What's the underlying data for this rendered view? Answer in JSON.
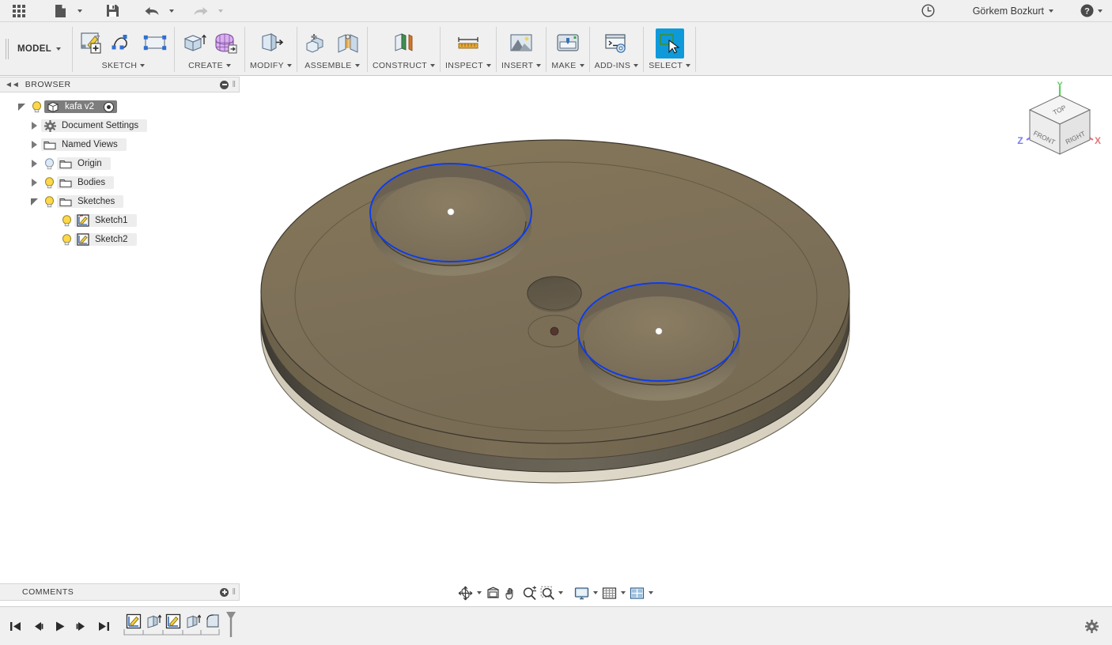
{
  "app": {
    "title": "Fusion 360",
    "user_name": "Görkem Bozkurt",
    "workspace": "MODEL"
  },
  "quick_access": {
    "items": [
      {
        "name": "app-grid-menu",
        "label": "Show Data Panel",
        "icon": "grid-icon"
      },
      {
        "name": "file-menu",
        "label": "File",
        "icon": "file-icon",
        "has_caret": true
      },
      {
        "name": "save-button",
        "label": "Save",
        "icon": "save-icon"
      },
      {
        "name": "undo-button",
        "label": "Undo",
        "icon": "undo-arrow-icon",
        "has_caret": true
      },
      {
        "name": "redo-button",
        "label": "Redo",
        "icon": "redo-arrow-icon",
        "has_caret": true,
        "disabled": true
      }
    ],
    "recent_icon": "clock-icon",
    "help_label": "Help",
    "help_icon": "question-mark-icon"
  },
  "ribbon": {
    "workspace_label": "MODEL",
    "panels": [
      {
        "title": "SKETCH",
        "tools": [
          {
            "name": "create-sketch-tool",
            "label": "Create Sketch",
            "icon": "sketch-plus-icon"
          },
          {
            "name": "spline-tool",
            "label": "Spline",
            "icon": "spline-icon"
          },
          {
            "name": "rectangle-tool",
            "label": "Rectangle",
            "icon": "rectangle-icon"
          }
        ]
      },
      {
        "title": "CREATE",
        "tools": [
          {
            "name": "extrude-tool",
            "label": "Extrude",
            "icon": "extrude-icon"
          },
          {
            "name": "create-form-tool",
            "label": "Create Form",
            "icon": "form-mesh-icon"
          }
        ]
      },
      {
        "title": "MODIFY",
        "tools": [
          {
            "name": "press-pull-tool",
            "label": "Press Pull",
            "icon": "press-pull-icon"
          }
        ]
      },
      {
        "title": "ASSEMBLE",
        "tools": [
          {
            "name": "new-component-tool",
            "label": "New Component",
            "icon": "new-component-icon"
          },
          {
            "name": "joint-tool",
            "label": "Joint",
            "icon": "joint-icon"
          }
        ]
      },
      {
        "title": "CONSTRUCT",
        "tools": [
          {
            "name": "offset-plane-tool",
            "label": "Offset Plane",
            "icon": "offset-plane-icon"
          }
        ]
      },
      {
        "title": "INSPECT",
        "tools": [
          {
            "name": "measure-tool",
            "label": "Measure",
            "icon": "ruler-icon"
          }
        ]
      },
      {
        "title": "INSERT",
        "tools": [
          {
            "name": "insert-image-tool",
            "label": "Insert Image",
            "icon": "image-icon"
          }
        ]
      },
      {
        "title": "MAKE",
        "tools": [
          {
            "name": "3d-print-tool",
            "label": "3D Print",
            "icon": "printer-icon"
          }
        ]
      },
      {
        "title": "ADD-INS",
        "tools": [
          {
            "name": "scripts-addins-tool",
            "label": "Scripts and Add-Ins",
            "icon": "console-gear-icon"
          }
        ]
      },
      {
        "title": "SELECT",
        "tools": [
          {
            "name": "select-tool",
            "label": "Select",
            "icon": "select-cursor-icon",
            "active": true
          }
        ]
      }
    ]
  },
  "browser": {
    "title": "BROWSER",
    "collapse_icon": "collapse-left-icon",
    "minimize_icon": "minus-circle-icon",
    "tree": [
      {
        "name": "kafa v2",
        "indent": 0,
        "twisty": "expanded",
        "bulb": "on",
        "icon": "component-icon",
        "selected": true,
        "has_radio": true
      },
      {
        "name": "Document Settings",
        "indent": 1,
        "twisty": "collapsed",
        "bulb": "none",
        "icon": "gear-icon",
        "selected": false
      },
      {
        "name": "Named Views",
        "indent": 1,
        "twisty": "collapsed",
        "bulb": "none",
        "icon": "folder-icon",
        "selected": false
      },
      {
        "name": "Origin",
        "indent": 1,
        "twisty": "collapsed",
        "bulb": "off",
        "icon": "folder-icon",
        "selected": false
      },
      {
        "name": "Bodies",
        "indent": 1,
        "twisty": "collapsed",
        "bulb": "on",
        "icon": "folder-icon",
        "selected": false
      },
      {
        "name": "Sketches",
        "indent": 1,
        "twisty": "expanded",
        "bulb": "on",
        "icon": "folder-icon",
        "selected": false
      },
      {
        "name": "Sketch1",
        "indent": 2,
        "twisty": "none",
        "bulb": "on",
        "icon": "sketch-red-icon",
        "selected": false
      },
      {
        "name": "Sketch2",
        "indent": 2,
        "twisty": "none",
        "bulb": "on",
        "icon": "sketch-icon",
        "selected": false
      }
    ]
  },
  "comments": {
    "title": "COMMENTS",
    "add_icon": "plus-circle-icon"
  },
  "view_cube": {
    "faces": {
      "top": "TOP",
      "front": "FRONT",
      "right": "RIGHT"
    },
    "axes": [
      {
        "label": "X",
        "color": "#e8747c"
      },
      {
        "label": "Y",
        "color": "#5fce5f"
      },
      {
        "label": "Z",
        "color": "#7b7bf0"
      }
    ]
  },
  "nav_bar": {
    "items": [
      {
        "name": "orbit-tool",
        "label": "Orbit",
        "icon": "orbit-icon",
        "has_caret": true
      },
      {
        "name": "look-at-tool",
        "label": "Look At",
        "icon": "look-at-icon",
        "has_caret": false
      },
      {
        "name": "pan-tool",
        "label": "Pan",
        "icon": "hand-icon",
        "has_caret": false
      },
      {
        "name": "zoom-tool",
        "label": "Zoom",
        "icon": "magnifier-plusminus-icon",
        "has_caret": false
      },
      {
        "name": "zoom-window-tool",
        "label": "Fit",
        "icon": "magnifier-window-icon",
        "has_caret": true
      },
      {
        "name": "display-settings",
        "label": "Display Settings",
        "icon": "monitor-icon",
        "has_caret": true
      },
      {
        "name": "grid-snaps",
        "label": "Grid and Snaps",
        "icon": "grid-square-icon",
        "has_caret": true
      },
      {
        "name": "viewports",
        "label": "Viewports",
        "icon": "viewports-icon",
        "has_caret": true
      }
    ]
  },
  "timeline": {
    "playback": [
      {
        "name": "jump-to-beginning-button",
        "label": "Go to Beginning",
        "icon": "skip-back-icon"
      },
      {
        "name": "step-back-button",
        "label": "Step Back",
        "icon": "step-back-icon"
      },
      {
        "name": "play-button",
        "label": "Play",
        "icon": "play-icon"
      },
      {
        "name": "step-forward-button",
        "label": "Step Forward",
        "icon": "step-forward-icon"
      },
      {
        "name": "jump-to-end-button",
        "label": "Go to End",
        "icon": "skip-forward-icon"
      }
    ],
    "features": [
      {
        "name": "timeline-feature-sketch1",
        "label": "Sketch1",
        "icon": "sketch-icon"
      },
      {
        "name": "timeline-feature-extrude1",
        "label": "Extrude1",
        "icon": "extrude-icon"
      },
      {
        "name": "timeline-feature-sketch2",
        "label": "Sketch2",
        "icon": "sketch-icon"
      },
      {
        "name": "timeline-feature-extrude2",
        "label": "Extrude2",
        "icon": "extrude-icon"
      },
      {
        "name": "timeline-feature-fillet1",
        "label": "Fillet1",
        "icon": "fillet-icon"
      }
    ],
    "marker_name": "timeline-marker",
    "settings_icon": "gear-icon"
  },
  "model": {
    "description": "Cylindrical disc part with two large counterbored pockets, one through hole and one small center hole",
    "body_color": "#7d7059",
    "rim_color": "#58534a",
    "base_color": "#ddd7c9",
    "sketch_color": "#0b3cf0",
    "point_color": "#ffffff",
    "features": [
      {
        "name": "pocket-upper-left",
        "selected_sketch": true,
        "center_point": true
      },
      {
        "name": "pocket-lower-right",
        "selected_sketch": true,
        "center_point": true
      },
      {
        "name": "through-hole-center",
        "selected_sketch": false,
        "center_point": false
      },
      {
        "name": "small-hole-center",
        "selected_sketch": false,
        "center_point": true
      }
    ]
  },
  "colors": {
    "accent": "#0e9ada",
    "chrome_bg": "#f0f0f0",
    "canvas_bg": "#ffffff",
    "text": "#3a3a3a"
  }
}
